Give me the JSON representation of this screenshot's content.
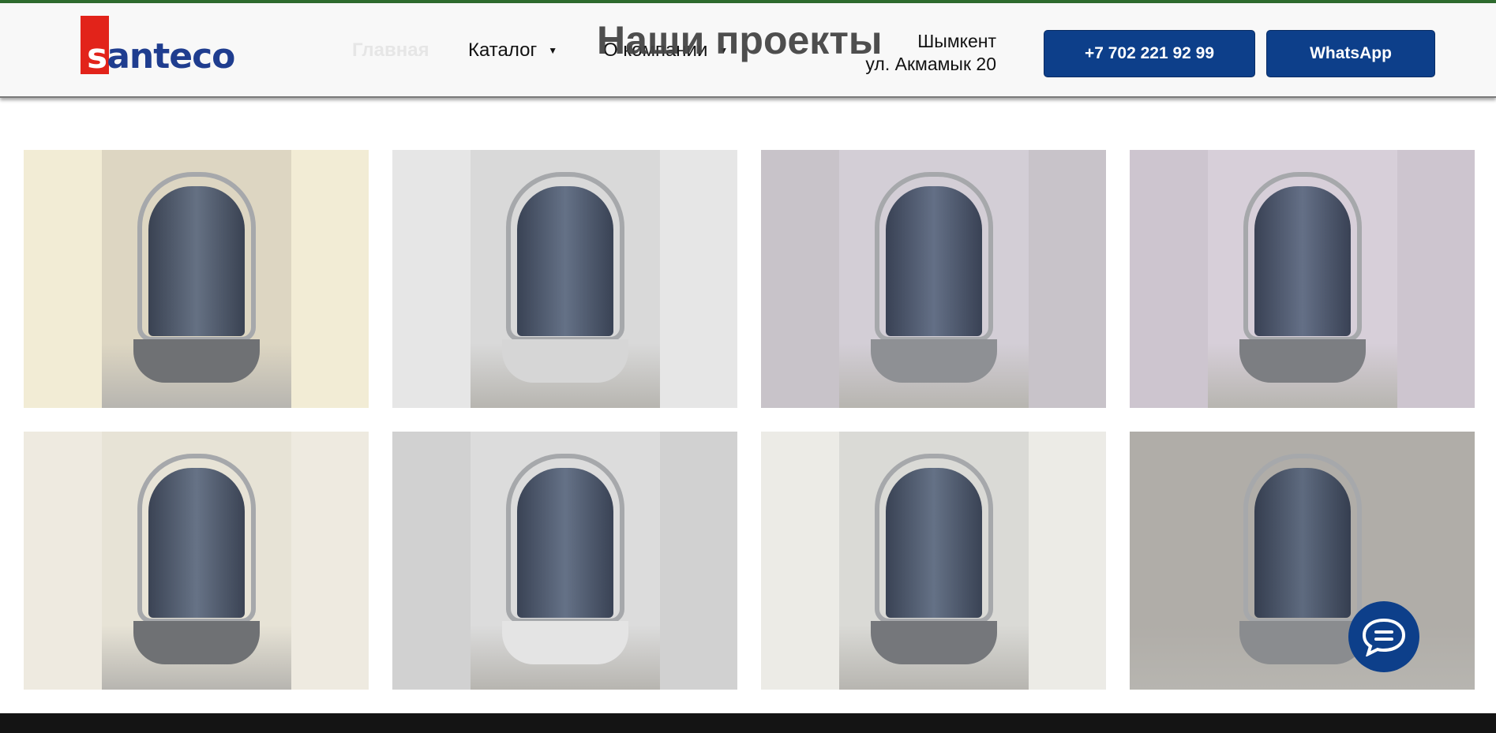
{
  "brand": {
    "logo_text_s": "s",
    "logo_text_rest": "anteco",
    "accent": "#e2231a",
    "primary": "#1f3d8f"
  },
  "nav": {
    "home": "Главная",
    "catalog": "Каталог",
    "about": "О компании",
    "caret": "▼"
  },
  "page": {
    "title": "Наши проекты"
  },
  "contact": {
    "city": "Шымкент",
    "street": "ул. Акмамык 20",
    "phone_button": "+7 702 221 92 99",
    "whatsapp_button": "WhatsApp",
    "button_color": "#0d3f8a"
  },
  "gallery": {
    "items": [
      {
        "bg": "#f2ecd5",
        "photo_bg": "#ddd6c2",
        "tray": "#6f7174"
      },
      {
        "bg": "#e6e6e6",
        "photo_bg": "#d9d9d9",
        "tray": "#d6d6d6"
      },
      {
        "bg": "#c8c3c9",
        "photo_bg": "#d3ced6",
        "tray": "#8e9094"
      },
      {
        "bg": "#cdc5cf",
        "photo_bg": "#d7cfd9",
        "tray": "#7c7e82"
      },
      {
        "bg": "#eeeae0",
        "photo_bg": "#e7e3d6",
        "tray": "#6f7174"
      },
      {
        "bg": "#d1d1d1",
        "photo_bg": "#dcdcdc",
        "tray": "#e4e4e4"
      },
      {
        "bg": "#ecebe6",
        "photo_bg": "#dadad6",
        "tray": "#75777b"
      },
      {
        "bg": "#9c9a96",
        "photo_bg": "#b0ada8",
        "tray": "#8a8c8f"
      }
    ]
  },
  "chat": {
    "icon": "chat-bubble-icon"
  }
}
